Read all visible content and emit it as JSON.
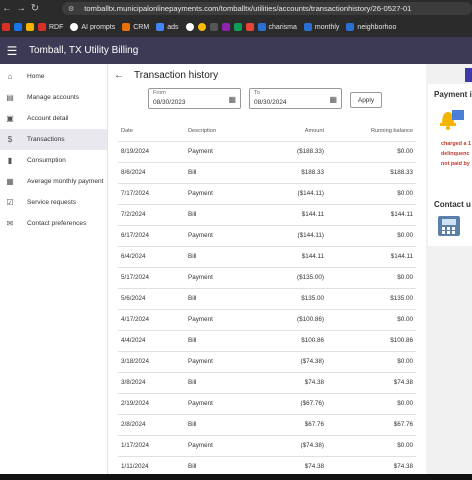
{
  "browser": {
    "url": "tomballtx.municipalonlinepayments.com/tomballtx/utilities/accounts/transactionhistory/26-0527-01",
    "bookmarks": [
      "RDF",
      "AI prompts",
      "CRM",
      "ads",
      "charisma",
      "monthly",
      "neighborhoo"
    ]
  },
  "header": {
    "title": "Tomball, TX  Utility Billing"
  },
  "sidebar": {
    "items": [
      {
        "label": "Home",
        "icon": "home-icon"
      },
      {
        "label": "Manage accounts",
        "icon": "accounts-icon"
      },
      {
        "label": "Account detail",
        "icon": "account-detail-icon"
      },
      {
        "label": "Transactions",
        "icon": "dollar-icon"
      },
      {
        "label": "Consumption",
        "icon": "consumption-icon"
      },
      {
        "label": "Average monthly payment",
        "icon": "calendar-icon"
      },
      {
        "label": "Service requests",
        "icon": "checkbox-icon"
      },
      {
        "label": "Contact preferences",
        "icon": "mail-icon"
      }
    ]
  },
  "page": {
    "title": "Transaction history",
    "from_label": "From",
    "from_value": "08/30/2023",
    "to_label": "To",
    "to_value": "08/30/2024",
    "apply_label": "Apply"
  },
  "table": {
    "headers": [
      "Date",
      "Description",
      "Amount",
      "Running balance"
    ],
    "rows": [
      [
        "8/19/2024",
        "Payment",
        "($188.33)",
        "$0.00"
      ],
      [
        "8/6/2024",
        "Bill",
        "$188.33",
        "$188.33"
      ],
      [
        "7/17/2024",
        "Payment",
        "($144.11)",
        "$0.00"
      ],
      [
        "7/2/2024",
        "Bill",
        "$144.11",
        "$144.11"
      ],
      [
        "6/17/2024",
        "Payment",
        "($144.11)",
        "$0.00"
      ],
      [
        "6/4/2024",
        "Bill",
        "$144.11",
        "$144.11"
      ],
      [
        "5/17/2024",
        "Payment",
        "($135.00)",
        "$0.00"
      ],
      [
        "5/6/2024",
        "Bill",
        "$135.00",
        "$135.00"
      ],
      [
        "4/17/2024",
        "Payment",
        "($100.86)",
        "$0.00"
      ],
      [
        "4/4/2024",
        "Bill",
        "$100.86",
        "$100.86"
      ],
      [
        "3/18/2024",
        "Payment",
        "($74.38)",
        "$0.00"
      ],
      [
        "3/8/2024",
        "Bill",
        "$74.38",
        "$74.38"
      ],
      [
        "2/19/2024",
        "Payment",
        "($67.76)",
        "$0.00"
      ],
      [
        "2/8/2024",
        "Bill",
        "$67.76",
        "$67.76"
      ],
      [
        "1/17/2024",
        "Payment",
        "($74.38)",
        "$0.00"
      ],
      [
        "1/11/2024",
        "Bill",
        "$74.38",
        "$74.38"
      ]
    ]
  },
  "right_panel": {
    "payment_title": "Payment i",
    "warning_lines": [
      "charged a 1",
      "delinquenc",
      "not paid by"
    ],
    "contact_title": "Contact u"
  },
  "colors": {
    "header_bg": "#3d3a55",
    "accent": "#3d3aa8",
    "warning": "#c0392b"
  }
}
